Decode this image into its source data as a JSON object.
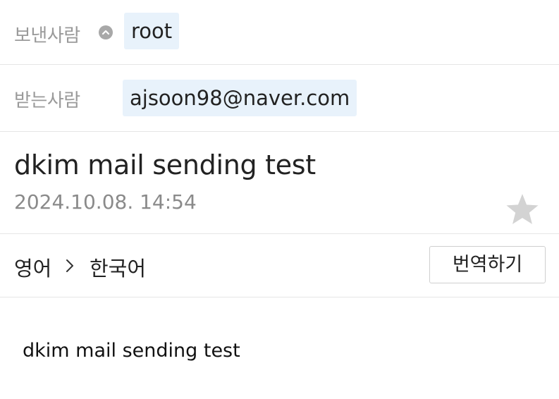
{
  "header": {
    "sender_label": "보낸사람",
    "sender_value": "root",
    "recipient_label": "받는사람",
    "recipient_value": "ajsoon98@naver.com"
  },
  "message": {
    "subject": "dkim mail sending test",
    "date": "2024.10.08. 14:54",
    "body": "dkim mail sending test"
  },
  "translation": {
    "source_language": "영어",
    "target_language": "한국어",
    "translate_button_label": "번역하기"
  },
  "icons": {
    "sender_toggle": "chevron-up-circle-icon",
    "star": "star-icon",
    "language_arrow": "chevron-right-icon"
  },
  "colors": {
    "chip_background": "#e8f2fb",
    "label_text": "#9a9a9a",
    "star": "#d3d3d3",
    "divider": "#e6e6e6"
  }
}
